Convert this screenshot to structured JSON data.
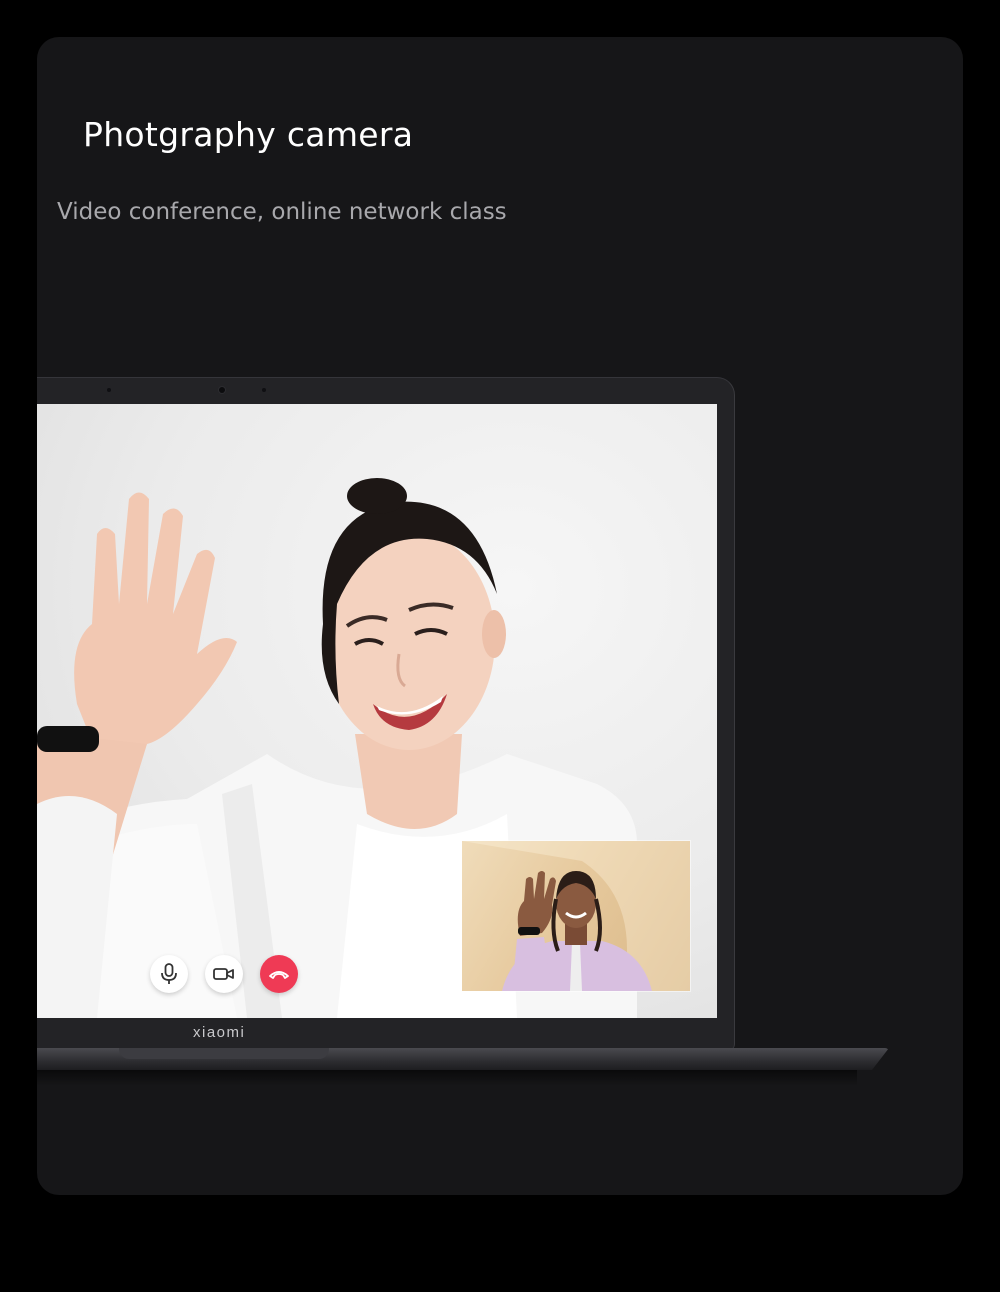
{
  "header": {
    "title": "Photgraphy camera",
    "subtitle": "Video conference, online network class"
  },
  "laptop": {
    "brand": "xiaomi"
  },
  "call": {
    "controls": [
      {
        "name": "microphone",
        "icon": "microphone-icon"
      },
      {
        "name": "camera",
        "icon": "video-camera-icon"
      },
      {
        "name": "hang-up",
        "icon": "phone-hangup-icon"
      }
    ],
    "colors": {
      "hangup": "#ef3a55",
      "control_bg": "#ffffff"
    }
  },
  "video": {
    "main_participant": "smiling woman waving",
    "self_view": "woman waving in pink jacket"
  }
}
